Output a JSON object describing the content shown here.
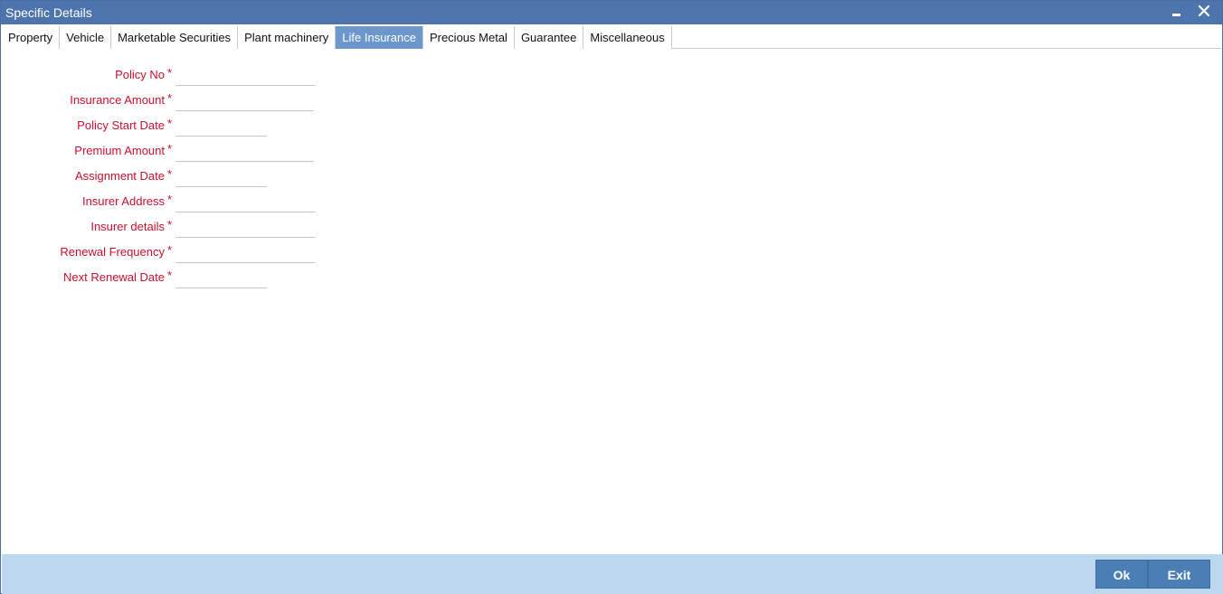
{
  "window": {
    "title": "Specific Details"
  },
  "tabs": [
    {
      "label": "Property"
    },
    {
      "label": "Vehicle"
    },
    {
      "label": "Marketable Securities"
    },
    {
      "label": "Plant machinery"
    },
    {
      "label": "Life Insurance",
      "active": true
    },
    {
      "label": "Precious Metal"
    },
    {
      "label": "Guarantee"
    },
    {
      "label": "Miscellaneous"
    }
  ],
  "form": {
    "required_marker": "*",
    "fields": [
      {
        "label": "Policy No",
        "value": ""
      },
      {
        "label": "Insurance Amount",
        "value": ""
      },
      {
        "label": "Policy Start Date",
        "value": ""
      },
      {
        "label": "Premium Amount",
        "value": ""
      },
      {
        "label": "Assignment Date",
        "value": ""
      },
      {
        "label": "Insurer Address",
        "value": ""
      },
      {
        "label": "Insurer details",
        "value": ""
      },
      {
        "label": "Renewal Frequency",
        "value": ""
      },
      {
        "label": "Next Renewal Date",
        "value": ""
      }
    ]
  },
  "footer": {
    "ok_label": "Ok",
    "exit_label": "Exit"
  },
  "colors": {
    "titlebar": "#4d74ad",
    "active_tab": "#6c97cc",
    "label_red": "#c8102e",
    "footer_bg": "#bdd7ee",
    "button_bg": "#4a7eb5"
  }
}
